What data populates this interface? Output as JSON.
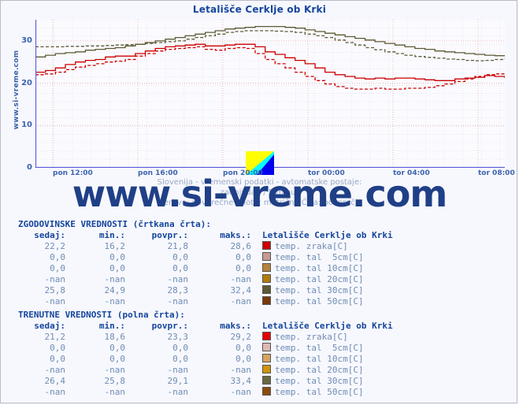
{
  "title": "Letališče Cerklje ob Krki",
  "site_vertical": "www.si-vreme.com",
  "watermark": "www.si-vreme.com",
  "subtitle": {
    "line1": "Slovenija - vremenski podatki - avtomatske postaje:",
    "line2": "zadnji dan / 5 minut",
    "line3": "Meritve: povprečne  Enote: metrične  Črta: povprečje"
  },
  "chart_data": {
    "type": "line",
    "title": "Letališče Cerklje ob Krki",
    "xlabel": "",
    "ylabel": "",
    "ylim": [
      0,
      35
    ],
    "yticks": [
      0,
      10,
      20,
      30
    ],
    "ytick_labels": [
      "0",
      "10",
      "20",
      "30"
    ],
    "xtick_labels": [
      "pon 12:00",
      "pon 16:00",
      "pon 20:00",
      "tor 00:00",
      "tor 04:00",
      "tor 08:00"
    ],
    "grid": true,
    "legend_position": "below-table",
    "x": [
      0,
      1,
      2,
      3,
      4,
      5,
      6,
      7,
      8,
      9,
      10,
      11,
      12,
      13,
      14,
      15,
      16,
      17,
      18,
      19,
      20,
      21,
      22,
      23,
      24,
      25,
      26,
      27,
      28,
      29,
      30,
      31,
      32,
      33,
      34,
      35,
      36,
      37,
      38,
      39,
      40,
      41,
      42,
      43,
      44,
      45,
      46,
      47
    ],
    "series": [
      {
        "name": "temp. zraka[C] (trenutne)",
        "color": "#cc0000",
        "style": "solid",
        "values": [
          22.6,
          23.0,
          23.6,
          24.4,
          25.0,
          25.4,
          25.6,
          26.2,
          26.4,
          26.4,
          27.0,
          27.6,
          28.2,
          28.6,
          28.8,
          29.0,
          29.2,
          28.8,
          28.8,
          29.0,
          29.2,
          29.2,
          28.6,
          27.4,
          26.8,
          26.0,
          25.4,
          24.6,
          23.6,
          22.6,
          22.0,
          21.6,
          21.2,
          21.0,
          21.2,
          21.0,
          21.2,
          21.2,
          21.0,
          20.8,
          20.6,
          20.6,
          21.0,
          21.2,
          21.4,
          21.8,
          21.6,
          21.2
        ]
      },
      {
        "name": "temp. zraka[C] (zgodovinske)",
        "color": "#cc0000",
        "style": "dashed",
        "values": [
          22.0,
          22.2,
          22.6,
          23.2,
          23.8,
          24.2,
          24.6,
          25.0,
          25.2,
          25.6,
          26.4,
          27.0,
          27.6,
          28.0,
          28.2,
          28.4,
          28.6,
          28.0,
          27.8,
          28.2,
          28.4,
          28.2,
          27.0,
          25.6,
          24.6,
          23.6,
          22.6,
          21.6,
          20.6,
          19.8,
          19.2,
          18.8,
          18.6,
          18.6,
          18.8,
          18.6,
          18.6,
          18.8,
          18.8,
          19.0,
          19.4,
          19.8,
          20.4,
          21.0,
          21.6,
          22.0,
          22.2,
          22.2
        ]
      },
      {
        "name": "temp. tal 30cm[C] (trenutne)",
        "color": "#5c5a34",
        "style": "solid",
        "values": [
          26.2,
          26.6,
          27.0,
          27.2,
          27.4,
          27.8,
          28.0,
          28.2,
          28.4,
          28.8,
          29.2,
          29.6,
          30.0,
          30.4,
          30.8,
          31.2,
          31.6,
          32.0,
          32.4,
          32.8,
          33.0,
          33.2,
          33.4,
          33.4,
          33.4,
          33.2,
          33.0,
          32.6,
          32.2,
          31.8,
          31.4,
          31.0,
          30.6,
          30.2,
          29.8,
          29.4,
          29.0,
          28.6,
          28.2,
          28.0,
          27.6,
          27.4,
          27.2,
          27.0,
          26.8,
          26.6,
          26.5,
          26.4
        ]
      },
      {
        "name": "temp. tal 30cm[C] (zgodovinske)",
        "color": "#5c5a34",
        "style": "dashed",
        "values": [
          28.6,
          28.6,
          28.6,
          28.7,
          28.7,
          28.8,
          28.8,
          28.9,
          29.0,
          29.1,
          29.2,
          29.4,
          29.6,
          29.8,
          30.0,
          30.4,
          30.8,
          31.2,
          31.6,
          32.0,
          32.2,
          32.4,
          32.4,
          32.4,
          32.3,
          32.2,
          32.0,
          31.6,
          31.2,
          30.8,
          30.2,
          29.6,
          29.0,
          28.4,
          27.9,
          27.4,
          27.0,
          26.6,
          26.3,
          26.1,
          25.9,
          25.7,
          25.6,
          25.4,
          25.3,
          25.4,
          25.6,
          25.8
        ]
      }
    ]
  },
  "tables": [
    {
      "heading": "ZGODOVINSKE VREDNOSTI (črtkana črta):",
      "columns": [
        "sedaj:",
        "min.:",
        "povpr.:",
        "maks.:"
      ],
      "station_label": "Letališče Cerklje ob Krki",
      "rows": [
        {
          "sedaj": "22,2",
          "min": "16,2",
          "povpr": "21,8",
          "maks": "28,6",
          "color": "#cc0000",
          "label": "temp. zraka[C]"
        },
        {
          "sedaj": "0,0",
          "min": "0,0",
          "povpr": "0,0",
          "maks": "0,0",
          "color": "#c79a93",
          "label": "temp. tal  5cm[C]"
        },
        {
          "sedaj": "0,0",
          "min": "0,0",
          "povpr": "0,0",
          "maks": "0,0",
          "color": "#b8823c",
          "label": "temp. tal 10cm[C]"
        },
        {
          "sedaj": "-nan",
          "min": "-nan",
          "povpr": "-nan",
          "maks": "-nan",
          "color": "#b07d0c",
          "label": "temp. tal 20cm[C]"
        },
        {
          "sedaj": "25,8",
          "min": "24,9",
          "povpr": "28,3",
          "maks": "32,4",
          "color": "#5c5a34",
          "label": "temp. tal 30cm[C]"
        },
        {
          "sedaj": "-nan",
          "min": "-nan",
          "povpr": "-nan",
          "maks": "-nan",
          "color": "#7a3a0a",
          "label": "temp. tal 50cm[C]"
        }
      ]
    },
    {
      "heading": "TRENUTNE VREDNOSTI (polna črta):",
      "columns": [
        "sedaj:",
        "min.:",
        "povpr.:",
        "maks.:"
      ],
      "station_label": "Letališče Cerklje ob Krki",
      "rows": [
        {
          "sedaj": "21,2",
          "min": "18,6",
          "povpr": "23,3",
          "maks": "29,2",
          "color": "#e60000",
          "label": "temp. zraka[C]"
        },
        {
          "sedaj": "0,0",
          "min": "0,0",
          "povpr": "0,0",
          "maks": "0,0",
          "color": "#ddb9b4",
          "label": "temp. tal  5cm[C]"
        },
        {
          "sedaj": "0,0",
          "min": "0,0",
          "povpr": "0,0",
          "maks": "0,0",
          "color": "#d6a55e",
          "label": "temp. tal 10cm[C]"
        },
        {
          "sedaj": "-nan",
          "min": "-nan",
          "povpr": "-nan",
          "maks": "-nan",
          "color": "#cf940c",
          "label": "temp. tal 20cm[C]"
        },
        {
          "sedaj": "26,4",
          "min": "25,8",
          "povpr": "29,1",
          "maks": "33,4",
          "color": "#6b6940",
          "label": "temp. tal 30cm[C]"
        },
        {
          "sedaj": "-nan",
          "min": "-nan",
          "povpr": "-nan",
          "maks": "-nan",
          "color": "#8d4a0d",
          "label": "temp. tal 50cm[C]"
        }
      ]
    }
  ]
}
